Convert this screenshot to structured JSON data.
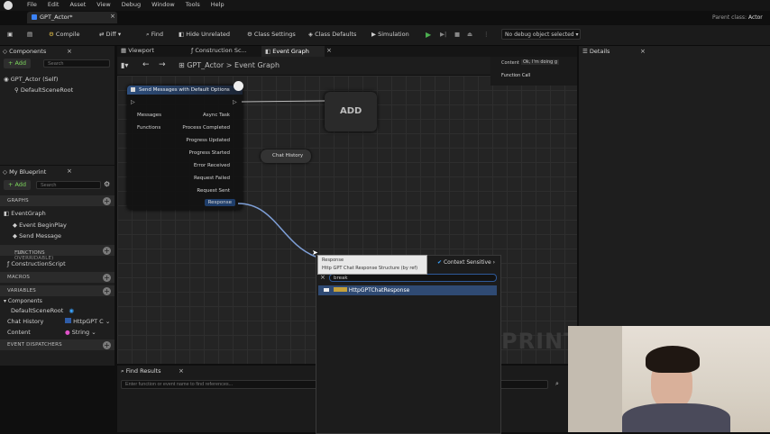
{
  "menu": [
    "File",
    "Edit",
    "Asset",
    "View",
    "Debug",
    "Window",
    "Tools",
    "Help"
  ],
  "doc_tab": "GPT_Actor*",
  "parent_class": {
    "label": "Parent class:",
    "value": "Actor"
  },
  "toolbar": {
    "compile": "Compile",
    "diff": "Diff",
    "find": "Find",
    "hide_unrelated": "Hide Unrelated",
    "class_settings": "Class Settings",
    "class_defaults": "Class Defaults",
    "simulation": "Simulation",
    "debug_select": "No debug object selected"
  },
  "components_panel": {
    "title": "Components",
    "add": "+ Add",
    "search_placeholder": "Search",
    "items": [
      "GPT_Actor (Self)",
      "DefaultSceneRoot"
    ]
  },
  "my_blueprint": {
    "title": "My Blueprint",
    "add": "+ Add",
    "search_placeholder": "Search",
    "sections": {
      "graphs": "GRAPHS",
      "functions": "FUNCTIONS",
      "functions_count": "(31 OVERRIDABLE)",
      "macros": "MACROS",
      "variables": "VARIABLES",
      "dispatchers": "EVENT DISPATCHERS"
    },
    "graph_items": [
      "EventGraph",
      "Event BeginPlay",
      "Send Message"
    ],
    "function_items": [
      "ConstructionScript"
    ],
    "var_group": "Components",
    "variables": [
      {
        "name": "DefaultSceneRoot",
        "type": ""
      },
      {
        "name": "Chat History",
        "type": "HttpGPT C"
      },
      {
        "name": "Content",
        "type": "String"
      }
    ]
  },
  "editor_tabs": [
    "Viewport",
    "Construction Sc...",
    "Event Graph"
  ],
  "breadcrumb": {
    "root": "GPT_Actor",
    "sep": ">",
    "leaf": "Event Graph"
  },
  "details_tab": "Details",
  "find_results": {
    "title": "Find Results",
    "placeholder": "Enter function or event name to find references..."
  },
  "overlay": {
    "content_label": "Content",
    "content_value": "Ok, I'm doing g",
    "function_call": "Function Call"
  },
  "node_send": {
    "title": "Send Messages with Default Options",
    "left_pins": [
      "Messages",
      "Functions"
    ],
    "right_pins": [
      "Async Task",
      "Process Completed",
      "Progress Updated",
      "Progress Started",
      "Error Received",
      "Request Failed",
      "Request Sent",
      "Response"
    ]
  },
  "node_add": "ADD",
  "node_chat": "Chat History",
  "tooltip": {
    "name": "Response",
    "type": "Http GPT Chat Response Structure (by ref)"
  },
  "context_menu": {
    "header": "Context Sensitive",
    "search_value": "break",
    "item": "HttpGPTChatResponse"
  },
  "watermark": "PRINT"
}
